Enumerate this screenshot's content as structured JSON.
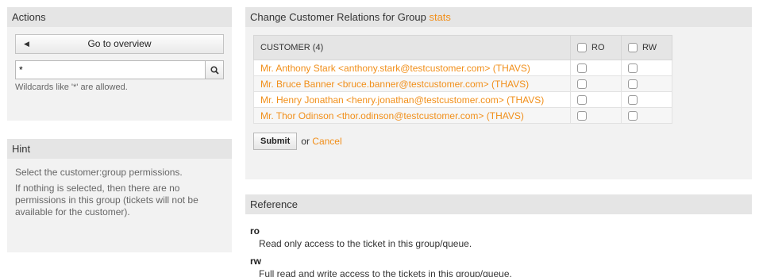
{
  "actions": {
    "title": "Actions",
    "overview_label": "Go to overview",
    "search_value": "*",
    "wildcard_note": "Wildcards like '*' are allowed."
  },
  "hint": {
    "title": "Hint",
    "paragraphs": [
      "Select the customer:group permissions.",
      "If nothing is selected, then there are no permissions in this group (tickets will not be available for the customer)."
    ]
  },
  "relations": {
    "title_prefix": "Change Customer Relations for Group",
    "group_name": "stats",
    "columns": {
      "customer": "CUSTOMER (4)",
      "ro": "RO",
      "rw": "RW"
    },
    "rows": [
      {
        "customer": "Mr. Anthony Stark <anthony.stark@testcustomer.com> (THAVS)",
        "ro": false,
        "rw": false
      },
      {
        "customer": "Mr. Bruce Banner <bruce.banner@testcustomer.com> (THAVS)",
        "ro": false,
        "rw": false
      },
      {
        "customer": "Mr. Henry Jonathan <henry.jonathan@testcustomer.com> (THAVS)",
        "ro": false,
        "rw": false
      },
      {
        "customer": "Mr. Thor Odinson <thor.odinson@testcustomer.com> (THAVS)",
        "ro": false,
        "rw": false
      }
    ],
    "submit_label": "Submit",
    "or_label": "or",
    "cancel_label": "Cancel"
  },
  "reference": {
    "title": "Reference",
    "items": [
      {
        "term": "ro",
        "definition": "Read only access to the ticket in this group/queue."
      },
      {
        "term": "rw",
        "definition": "Full read and write access to the tickets in this group/queue."
      }
    ]
  },
  "colors": {
    "accent": "#f18f1a",
    "panel_header": "#e5e5e5",
    "panel_body": "#f2f2f2"
  },
  "icons": {
    "overview": "caret-left-icon",
    "search": "magnifier-icon",
    "checkbox": "checkbox-icon"
  }
}
